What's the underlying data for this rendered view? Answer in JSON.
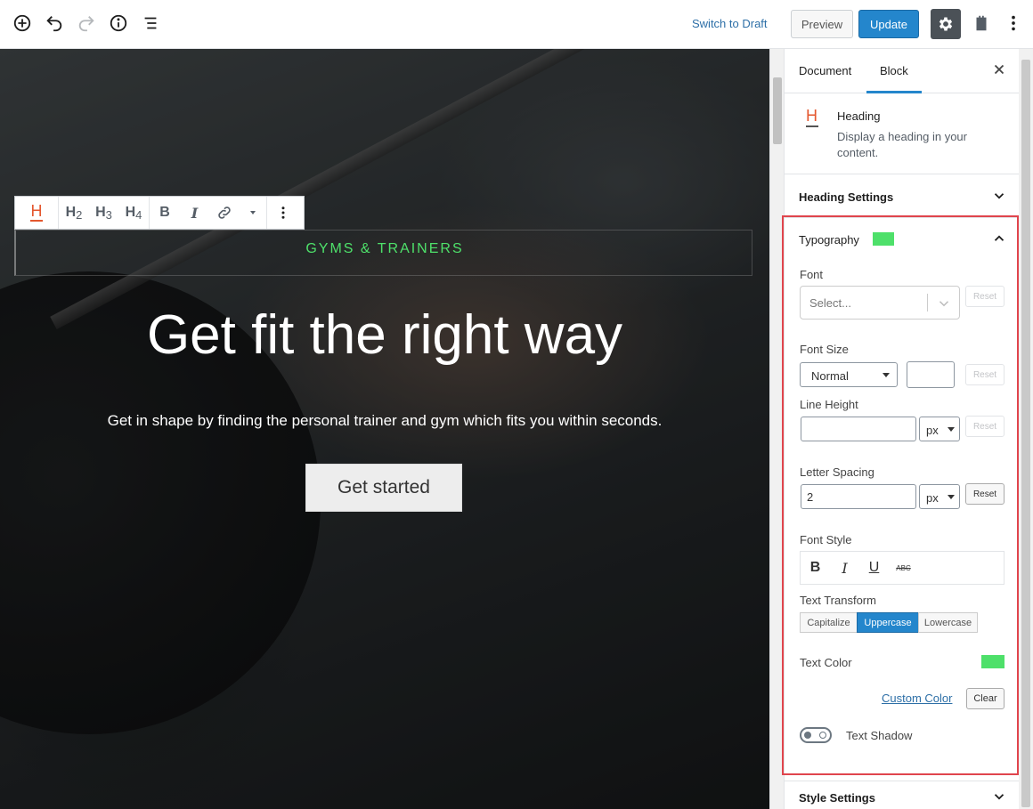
{
  "toolbar": {
    "switch_to_draft": "Switch to Draft",
    "preview": "Preview",
    "update": "Update",
    "accent_color": "#2486cc"
  },
  "block_toolbar": {
    "h2": "H",
    "h2_sub": "2",
    "h3": "H",
    "h3_sub": "3",
    "h4": "H",
    "h4_sub": "4",
    "bold": "B",
    "italic": "I"
  },
  "hero": {
    "eyebrow": "GYMS & TRAINERS",
    "eyebrow_color": "#4ee06a",
    "title": "Get fit the right way",
    "subtitle": "Get in shape by finding the personal trainer and gym which fits you within seconds.",
    "cta": "Get started"
  },
  "sidebar": {
    "tabs": [
      "Document",
      "Block"
    ],
    "active_tab": "Block",
    "block_card": {
      "title": "Heading",
      "description": "Display a heading in your content."
    },
    "heading_settings": "Heading Settings",
    "typography": {
      "title": "Typography",
      "swatch_color": "#4ee06a",
      "font_label": "Font",
      "font_placeholder": "Select...",
      "reset": "Reset",
      "font_size_label": "Font Size",
      "font_size_value": "Normal",
      "font_size_custom": "",
      "line_height_label": "Line Height",
      "line_height_value": "",
      "line_height_unit": "px",
      "letter_spacing_label": "Letter Spacing",
      "letter_spacing_value": "2",
      "letter_spacing_unit": "px",
      "font_style_label": "Font Style",
      "font_style_buttons": [
        "B",
        "I",
        "U",
        "ABC"
      ],
      "text_transform_label": "Text Transform",
      "text_transform_options": [
        "Capitalize",
        "Uppercase",
        "Lowercase"
      ],
      "text_transform_selected": "Uppercase",
      "text_color_label": "Text Color",
      "text_color": "#4ee06a",
      "custom_color": "Custom Color",
      "clear": "Clear",
      "text_shadow_label": "Text Shadow",
      "text_shadow_enabled": false
    },
    "style_settings": "Style Settings"
  }
}
